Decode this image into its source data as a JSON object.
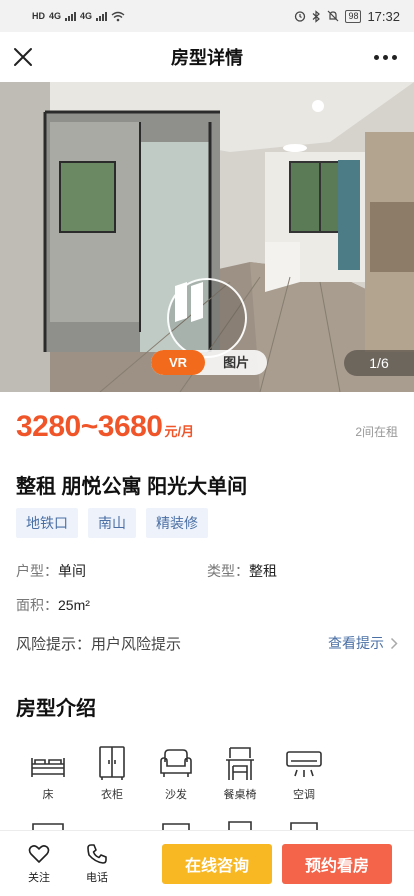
{
  "status_bar": {
    "left_badges": [
      "HD",
      "4G",
      "4G"
    ],
    "battery": "98",
    "time": "17:32"
  },
  "nav": {
    "title": "房型详情",
    "close_icon": "close-icon",
    "more_icon": "more-icon"
  },
  "gallery": {
    "tabs": [
      {
        "label": "VR",
        "active": true
      },
      {
        "label": "图片",
        "active": false
      }
    ],
    "counter": "1/6",
    "play_icon": "vr-play-icon"
  },
  "price": {
    "range": "3280~3680",
    "unit": "元/月",
    "rent_status": "2间在租"
  },
  "title": "整租 朋悦公寓 阳光大单间",
  "tags": [
    "地铁口",
    "南山",
    "精装修"
  ],
  "info": [
    [
      {
        "key": "户型：",
        "value": "单间"
      },
      {
        "key": "类型：",
        "value": "整租"
      }
    ],
    [
      {
        "key": "面积：",
        "value": "25m²"
      }
    ]
  ],
  "risk": {
    "label": "风险提示：用户风险提示",
    "link": "查看提示"
  },
  "section_title": "房型介绍",
  "facilities": [
    {
      "label": "床",
      "icon": "bed-icon"
    },
    {
      "label": "衣柜",
      "icon": "wardrobe-icon"
    },
    {
      "label": "沙发",
      "icon": "sofa-icon"
    },
    {
      "label": "餐桌椅",
      "icon": "dining-table-icon"
    },
    {
      "label": "空调",
      "icon": "air-conditioner-icon"
    }
  ],
  "bottom_bar": {
    "follow": "关注",
    "phone": "电话",
    "consult": "在线咨询",
    "book": "预约看房"
  },
  "colors": {
    "price": "#f0552a",
    "tag_text": "#4a6fa5",
    "tag_bg": "#eef3fb",
    "consult_btn": "#f8b824",
    "book_btn": "#f4644a",
    "vr_tab": "#f26a1b"
  }
}
